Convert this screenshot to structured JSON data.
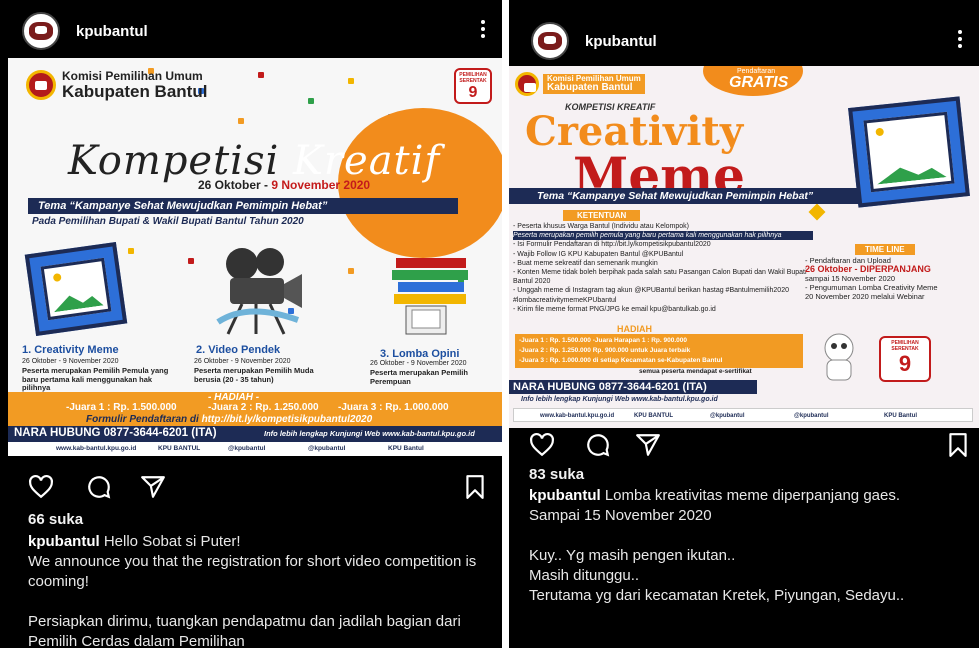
{
  "left_post": {
    "username": "kpubantul",
    "poster": {
      "org_line1": "Komisi Pemilihan Umum",
      "org_line2": "Kabupaten Bantul",
      "badge_top": "PEMILIHAN SERENTAK",
      "badge_number": "9",
      "title_part1": "Kompetisi",
      "title_part2": "Kreatif",
      "date_range_start": "26 Oktober - ",
      "date_range_end": "9 November 2020",
      "tema": "Tema “Kampanye Sehat Mewujudkan Pemimpin Hebat”",
      "pada": "Pada Pemilihan Bupati & Wakil Bupati Bantul Tahun 2020",
      "categories": [
        {
          "title": "1. Creativity Meme",
          "date": "26 Oktober - 9 November 2020",
          "desc": "Peserta merupakan Pemilih Pemula yang baru pertama kali menggunakan hak pilihnya"
        },
        {
          "title": "2. Video Pendek",
          "date": "26 Oktober - 9 November 2020",
          "desc": "Peserta merupakan Pemilih Muda berusia (20 - 35 tahun)"
        },
        {
          "title": "3. Lomba Opini",
          "date": "26 Oktober - 9 November 2020",
          "desc": "Peserta merupakan Pemilih Perempuan"
        }
      ],
      "hadiah_label": "- HADIAH -",
      "juara1": "-Juara 1 : Rp. 1.500.000",
      "juara2": "-Juara 2 : Rp. 1.250.000",
      "juara3": "-Juara 3 : Rp. 1.000.000",
      "formulir_prefix": "Formulir Pendaftaran di ",
      "formulir_link": "http://bit.ly/kompetisikpubantul2020",
      "nara_hubung": "NARA HUBUNG 0877-3644-6201 (ITA)",
      "info_web": "Info lebih lengkap Kunjungi Web www.kab-bantul.kpu.go.id",
      "footer_items": [
        "www.kab-bantul.kpu.go.id",
        "KPU BANTUL",
        "@kpubantul",
        "@kpubantul",
        "KPU Bantul"
      ]
    },
    "likes": "66 suka",
    "caption_user": "kpubantul",
    "caption_lines": [
      "Hello Sobat si Puter!",
      "We announce you that the registration for short video competition is cooming!",
      "",
      "Persiapkan dirimu, tuangkan pendapatmu dan jadilah bagian dari Pemilih Cerdas dalam Pemilihan"
    ]
  },
  "right_post": {
    "username": "kpubantul",
    "poster": {
      "org_line1": "Komisi Pemilihan Umum",
      "org_line2": "Kabupaten Bantul",
      "gratis_small": "Pendaftaran",
      "gratis": "GRATIS",
      "kompetisi_label": "KOMPETISI KREATIF",
      "title_line1": "Creativity",
      "title_line2": "Meme",
      "tema": "Tema “Kampanye Sehat Mewujudkan Pemimpin Hebat”",
      "ketentuan_label": "KETENTUAN",
      "ketentuan": [
        "- Peserta khusus Warga Bantul (Individu atau Kelompok)",
        "Peserta merupakan pemilih pemula yang baru pertama kali menggunakan hak pilihnya",
        "- Isi Formulir Pendaftaran di http://bit.ly/kompetisikpubantul2020",
        "- Wajib Follow IG KPU Kabupaten Bantul @KPUBantul",
        "- Buat meme sekreatif dan semenarik mungkin",
        "- Konten Meme tidak boleh berpihak pada salah satu Pasangan Calon Bupati dan Wakil Bupati Bantul 2020",
        "- Unggah meme di Instagram tag akun @KPUBantul berikan hastag #Bantulmemilih2020 #lombacreativitymemeKPUbantul",
        "- Kirim file meme format PNG/JPG ke email kpu@bantulkab.go.id"
      ],
      "timeline_label": "TIME LINE",
      "timeline": [
        "- Pendaftaran dan Upload",
        "26 Oktober - DIPERPANJANG",
        "sampai 15 November 2020",
        "- Pengumuman Lomba Creativity Meme",
        "20 November 2020 melalui Webinar"
      ],
      "hadiah_label": "HADIAH",
      "hadiah_lines": [
        "-Juara 1 : Rp. 1.500.000   -Juara Harapan 1 : Rp. 900.000",
        "-Juara 2 : Rp. 1.250.000   Rp. 900.000 untuk Juara terbaik",
        "-Juara 3 : Rp. 1.000.000   di setiap Kecamatan se-Kabupaten Bantul"
      ],
      "sertifikat": "semua peserta mendapat e-sertifikat",
      "pemilihan_badge": "PEMILIHAN SERENTAK",
      "badge_number": "9",
      "nara_hubung": "NARA HUBUNG 0877-3644-6201 (ITA)",
      "info_web": "Info lebih lengkap Kunjungi Web www.kab-bantul.kpu.go.id",
      "footer_items": [
        "www.kab-bantul.kpu.go.id",
        "KPU BANTUL",
        "@kpubantul",
        "@kpubantul",
        "KPU Bantul"
      ]
    },
    "likes": "83 suka",
    "caption_user": "kpubantul",
    "caption_lines": [
      "Lomba kreativitas meme diperpanjang gaes.",
      "Sampai 15 November 2020",
      "",
      "Kuy.. Yg masih pengen ikutan..",
      "Masih ditunggu..",
      "Terutama yg dari kecamatan Kretek, Piyungan, Sedayu.."
    ]
  },
  "icons": {
    "like": "heart-icon",
    "comment": "comment-icon",
    "share": "send-icon",
    "save": "bookmark-icon",
    "more": "more-vertical-icon"
  },
  "colors": {
    "background": "#000000",
    "navy": "#1d2b55",
    "orange": "#f29b23",
    "red": "#c21b1b"
  }
}
